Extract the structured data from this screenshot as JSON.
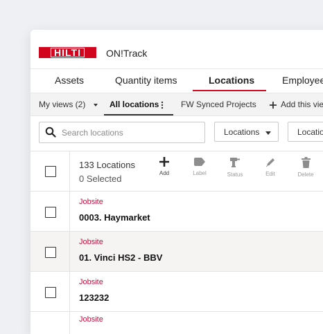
{
  "app": {
    "logo_text": "HILTI",
    "title": "ON!Track"
  },
  "tabs": [
    {
      "label": "Assets"
    },
    {
      "label": "Quantity items"
    },
    {
      "label": "Locations",
      "active": true
    },
    {
      "label": "Employees"
    }
  ],
  "viewbar": {
    "my_views": "My views (2)",
    "all_locations": "All locations",
    "synced": "FW Synced Projects",
    "add_view": "Add this view"
  },
  "search": {
    "placeholder": "Search locations",
    "value": ""
  },
  "filters": [
    {
      "label": "Locations"
    },
    {
      "label": "Location"
    }
  ],
  "list_header": {
    "count": "133 Locations",
    "selected": "0 Selected",
    "actions": [
      {
        "label": "Add",
        "icon": "plus-icon",
        "enabled": true
      },
      {
        "label": "Label",
        "icon": "tag-icon",
        "enabled": false
      },
      {
        "label": "Status",
        "icon": "drill-icon",
        "enabled": false
      },
      {
        "label": "Edit",
        "icon": "pencil-icon",
        "enabled": false
      },
      {
        "label": "Delete",
        "icon": "trash-icon",
        "enabled": false
      }
    ]
  },
  "rows": [
    {
      "type": "Jobsite",
      "name": "0003. Haymarket"
    },
    {
      "type": "Jobsite",
      "name": "01. Vinci HS2 - BBV"
    },
    {
      "type": "Jobsite",
      "name": "123232"
    },
    {
      "type": "Jobsite",
      "name": ""
    }
  ],
  "colors": {
    "brand_red": "#d2051e",
    "type_red": "#c1123e",
    "active_row": "#f6f3f3"
  }
}
